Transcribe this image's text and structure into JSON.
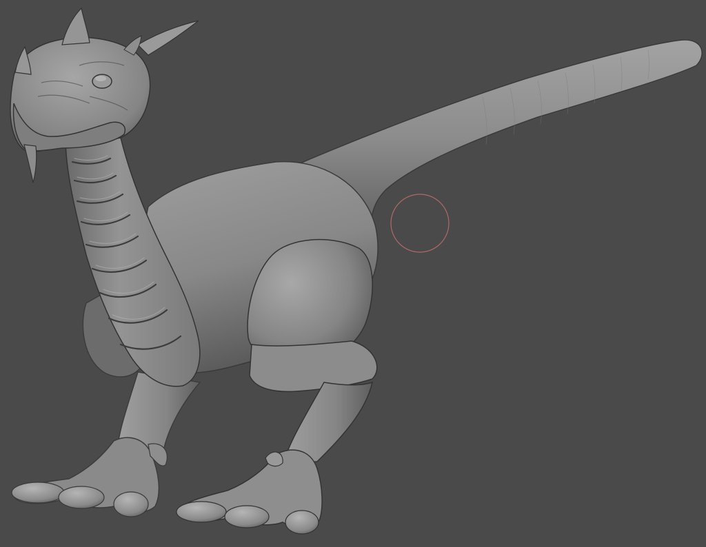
{
  "app": {
    "view": "3d-sculpt-viewport",
    "subject": "dinosaur-sculpt"
  },
  "viewport": {
    "background_color": "#4a4a4a"
  },
  "model": {
    "base_color": "#8f8f8f",
    "shadow_color": "#4e4e4e",
    "highlight_color": "#c9c9c9",
    "outline_color": "#2e2e2e"
  },
  "brush_cursor": {
    "color": "#b06a66",
    "icon": "brush-cursor-circle"
  }
}
